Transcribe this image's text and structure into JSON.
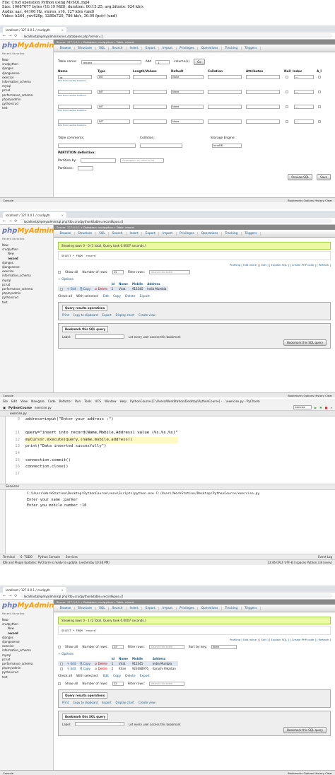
{
  "meta_lines": [
    "File: Crud operation Python using MySQL.mp4",
    "Size: 10687677 bytes (10.19 MiB), duration: 00:15:25, avg.bitrate: 924 kb/s",
    "Audio: aac, 44100 Hz, stereo, s16, 127 kb/s (und)",
    "Video: h264, yuv420p, 1280x720, 786 kb/s, 30.00 fps(r) (und)"
  ],
  "panel1": {
    "tab": "localhost / 127.0.0.1 / crudpyth",
    "url": "localhost/phpmyadmin/server_databases.php?server=1",
    "logo_a": "php",
    "logo_b": "MyAdmin",
    "logo_sub": "Recent  Favorites",
    "tree": [
      "New",
      "crudpython",
      "djangos",
      "djangoserve",
      "exercise",
      "information_schema",
      "mysql",
      "pcrud",
      "performance_schema",
      "phpmyadmin",
      "pythoncrud",
      "test"
    ],
    "crumb": "Server: 127.0.0.1 » Database: crudpython » Table: record",
    "menu": [
      "Browse",
      "Structure",
      "SQL",
      "Search",
      "Insert",
      "Export",
      "Import",
      "Privileges",
      "Operations",
      "Tracking",
      "Triggers"
    ],
    "table_name_label": "Table name:",
    "table_name_value": "record",
    "add_label": "Add",
    "add_value": "1",
    "columns_label": "column(s)",
    "go": "Go",
    "headers": [
      "Name",
      "Type",
      "Length/Values",
      "Default",
      "Collation",
      "Attributes",
      "Null",
      "Index",
      "A_I"
    ],
    "rows": [
      {
        "name": "id",
        "type": "INT",
        "default": "None",
        "index": "---"
      },
      {
        "name": "",
        "type": "INT",
        "default": "None",
        "index": "---"
      },
      {
        "name": "",
        "type": "INT",
        "default": "None",
        "index": "---"
      },
      {
        "name": "",
        "type": "INT",
        "default": "None",
        "index": "---"
      }
    ],
    "pick_central": "Pick from Central Columns",
    "table_comments": "Table comments:",
    "collation": "Collation:",
    "storage_engine": "Storage Engine:",
    "engine_value": "InnoDB",
    "partition_def": "PARTITION definition:",
    "partition_by": "Partition by:",
    "expr_placeholder": "Expression or column list",
    "partitions": "Partitions:",
    "preview_sql": "Preview SQL",
    "save": "Save",
    "console": "Console",
    "console_right": "Bookmarks  Options  History  Clear"
  },
  "panel2": {
    "tab": "localhost / 127.0.0.1 / crudpyth",
    "url": "localhost/phpmyadmin/sql.php?db=crudpython&table=record&pos=0",
    "tree": [
      "New",
      "crudpython",
      "New",
      "record",
      "djangos",
      "djangoserve",
      "exercise",
      "information_schema",
      "mysql",
      "pcrud",
      "performance_schema",
      "phpmyadmin",
      "pythoncrud",
      "test"
    ],
    "crumb": "Server: 127.0.0.1 » Database: crudpython » Table: record",
    "success": "Showing rows 0 - 0 (1 total, Query took 0.0007 seconds.)",
    "sql": "SELECT * FROM `record`",
    "profiling": "Profiling [ Edit inline ] [ Edit ] [ Explain SQL ] [ Create PHP code ] [ Refresh ]",
    "show_all": "Show all",
    "num_rows_label": "Number of rows:",
    "num_rows": "25",
    "filter_label": "Filter rows:",
    "filter_placeholder": "Search this table",
    "options": "+ Options",
    "cols": [
      "id",
      "Name",
      "Mobile",
      "Address"
    ],
    "data": [
      [
        "1",
        "Virat",
        "912345",
        "India Mumbia"
      ]
    ],
    "actions": [
      "Edit",
      "Copy",
      "Delete"
    ],
    "check_all": "Check all",
    "with_selected": "With selected:",
    "bulk": [
      "Edit",
      "Copy",
      "Delete",
      "Export"
    ],
    "qro": "Query results operations",
    "ops": [
      "Print",
      "Copy to clipboard",
      "Export",
      "Display chart",
      "Create view"
    ],
    "bookmark_legend": "Bookmark this SQL query",
    "label": "Label:",
    "every_user": "Let every user access this bookmark",
    "bookmark_btn": "Bookmark this SQL query",
    "console": "Console",
    "console_right": "Bookmarks  Options  History  Clear"
  },
  "panel3": {
    "menu": [
      "File",
      "Edit",
      "View",
      "Navigate",
      "Code",
      "Refactor",
      "Run",
      "Tools",
      "VCS",
      "Window",
      "Help",
      "PythonCourse [C:\\Users\\WorkStation\\Desktop\\PythonCourse] - ...\\exercise.py - PyCharm"
    ],
    "project": "PythonCourse",
    "file": "exercise.py",
    "run_config": "exercise",
    "line_numbers": [
      "9",
      "",
      "11",
      "12",
      "13",
      "14",
      "15",
      "16",
      "17"
    ],
    "code": [
      "address=input(\"Enter your address :\")",
      "",
      "query=\"insert into record(Name,Mobile,Address) value (%s,%s,%s)\"",
      "myCursor.execute(query,(name,mobile,address))",
      "print(\"Data inserted succesfully\")",
      "",
      "connection.commit()",
      "connection.close()",
      ""
    ],
    "services": "Services",
    "run_cmd": "C:\\Users\\WorkStation\\Desktop\\PythonCourse\\venv\\Scripts\\python.exe C:/Users/WorkStation/Desktop/PythonCourse/exercise.py",
    "out1": "Enter your name :parker",
    "out2": "Enter you mobile number :10",
    "bottom_tabs": [
      "Terminal",
      "6: TODO",
      "Python Console",
      "Services"
    ],
    "event_log": "Event Log",
    "status": "IDE and Plugin Updates: PyCharm is ready to update. (yesterday 10:38 PM)",
    "status_right": "13:46   CRLF   UTF-8   4 spaces   Python 3.8 (venv)"
  },
  "panel4": {
    "tab": "localhost / 127.0.0.1 / crudpyth",
    "url": "localhost/phpmyadmin/sql.php?db=crudpython&table=record&pos=0",
    "tree": [
      "New",
      "crudpython",
      "New",
      "record",
      "djangos",
      "djangoserve",
      "exercise",
      "information_schema",
      "mysql",
      "pcrud",
      "performance_schema",
      "phpmyadmin",
      "pythoncrud",
      "test"
    ],
    "crumb": "Server: 127.0.0.1 » Database: crudpython » Table: record",
    "success": "Showing rows 0 - 1 (2 total, Query took 0.0007 seconds.)",
    "sql": "SELECT * FROM `record`",
    "profiling": "Profiling [ Edit inline ] [ Edit ] [ Explain SQL ] [ Create PHP code ] [ Refresh ]",
    "sort_label": "Sort by key:",
    "sort_value": "None",
    "data": [
      [
        "1",
        "Virat",
        "912345",
        "India Mumbia"
      ],
      [
        "2",
        "Khan",
        "923088976",
        "Karachi Pakistan"
      ]
    ]
  }
}
